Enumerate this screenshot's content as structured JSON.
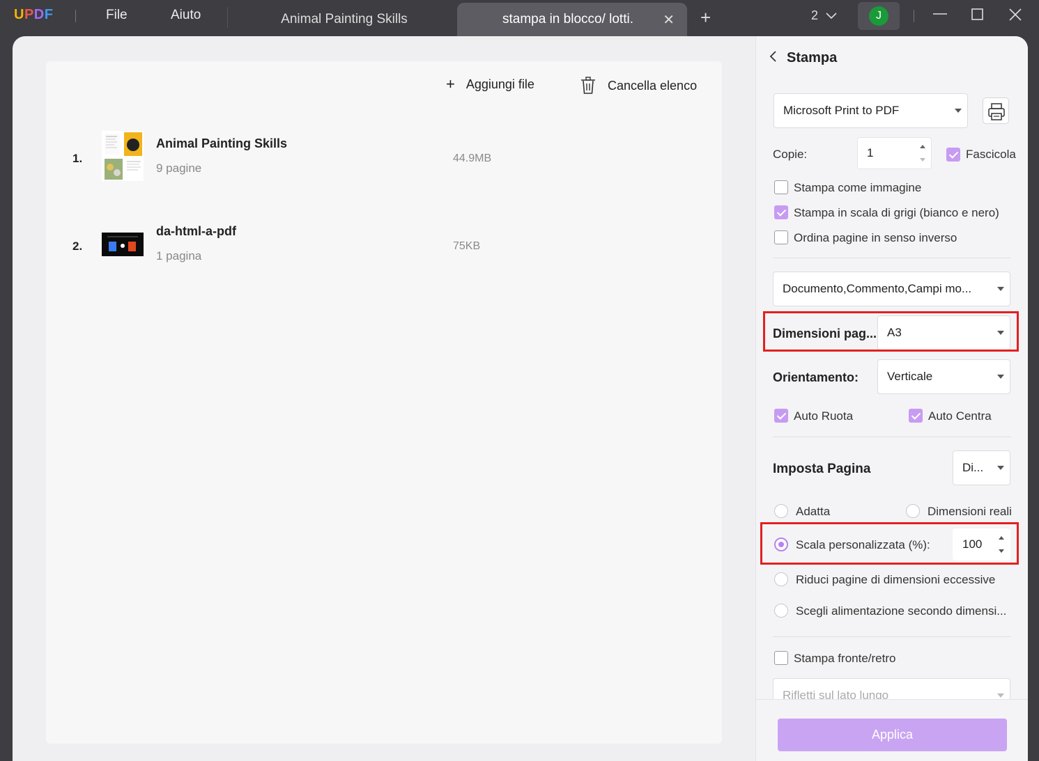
{
  "titlebar": {
    "logo": {
      "u": "U",
      "p": "P",
      "d": "D",
      "f": "F"
    },
    "menu_file": "File",
    "menu_help": "Aiuto",
    "tabs": [
      {
        "label": "Animal Painting Skills"
      },
      {
        "label": "stampa in blocco/ lotti."
      }
    ],
    "window_count": "2",
    "user_initial": "J"
  },
  "filelist": {
    "add_label": "Aggiungi file",
    "clear_label": "Cancella elenco",
    "files": [
      {
        "index": "1.",
        "name": "Animal Painting Skills",
        "pages": "9 pagine",
        "size": "44.9MB"
      },
      {
        "index": "2.",
        "name": "da-html-a-pdf",
        "pages": "1 pagina",
        "size": "75KB"
      }
    ]
  },
  "panel": {
    "title": "Stampa",
    "printer": "Microsoft Print to PDF",
    "copies_label": "Copie:",
    "copies_value": "1",
    "collate_label": "Fascicola",
    "print_as_image": "Stampa come immagine",
    "grayscale": "Stampa in scala di grigi (bianco e nero)",
    "reverse_order": "Ordina pagine in senso inverso",
    "content_select": "Documento,Commento,Campi mo...",
    "page_size_label": "Dimensioni pag...",
    "page_size_value": "A3",
    "orientation_label": "Orientamento:",
    "orientation_value": "Verticale",
    "auto_rotate": "Auto Ruota",
    "auto_center": "Auto Centra",
    "page_setup_label": "Imposta Pagina",
    "page_setup_value": "Di...",
    "fit": "Adatta",
    "actual_size": "Dimensioni reali",
    "custom_scale": "Scala personalizzata (%):",
    "custom_scale_value": "100",
    "shrink": "Riduci pagine di dimensioni eccessive",
    "choose_source": "Scegli alimentazione secondo dimensi...",
    "duplex": "Stampa fronte/retro",
    "flip_select": "Rifletti sul lato lungo",
    "apply": "Applica"
  }
}
